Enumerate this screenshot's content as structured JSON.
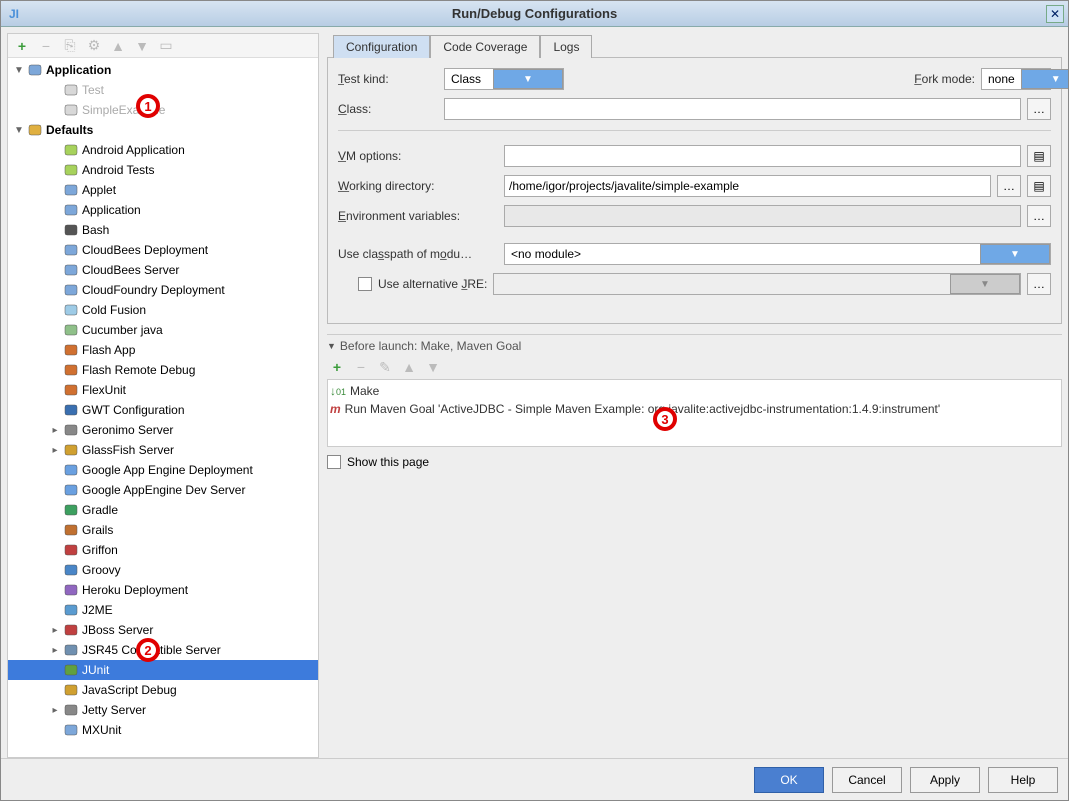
{
  "title": "Run/Debug Configurations",
  "toolbar": {
    "plus": "+",
    "minus": "−"
  },
  "tree": {
    "application": {
      "label": "Application",
      "items": [
        "Test",
        "SimpleExample"
      ]
    },
    "defaults": {
      "label": "Defaults",
      "items": [
        "Android Application",
        "Android Tests",
        "Applet",
        "Application",
        "Bash",
        "CloudBees Deployment",
        "CloudBees Server",
        "CloudFoundry Deployment",
        "Cold Fusion",
        "Cucumber java",
        "Flash App",
        "Flash Remote Debug",
        "FlexUnit",
        "GWT Configuration",
        "Geronimo Server",
        "GlassFish Server",
        "Google App Engine Deployment",
        "Google AppEngine Dev Server",
        "Gradle",
        "Grails",
        "Griffon",
        "Groovy",
        "Heroku Deployment",
        "J2ME",
        "JBoss Server",
        "JSR45 Compatible Server",
        "JUnit",
        "JavaScript Debug",
        "Jetty Server",
        "MXUnit"
      ],
      "selected_index": 26,
      "expandable_indices": [
        14,
        15,
        24,
        25,
        28
      ]
    }
  },
  "tabs": {
    "t0": "Configuration",
    "t1": "Code Coverage",
    "t2": "Logs"
  },
  "form": {
    "test_kind_label": "Test kind:",
    "test_kind_value": "Class",
    "fork_label": "Fork mode:",
    "fork_value": "none",
    "class_label": "Class:",
    "vm_label": "VM options:",
    "working_label": "Working directory:",
    "working_value": "/home/igor/projects/javalite/simple-example",
    "env_label": "Environment variables:",
    "classpath_label": "Use classpath of modu...",
    "classpath_value": "<no module>",
    "alt_jre_label": "Use alternative JRE:"
  },
  "before_launch": {
    "title": "Before launch: Make, Maven Goal",
    "items": [
      {
        "icon": "make",
        "text": "Make"
      },
      {
        "icon": "mvn",
        "text": "Run Maven Goal 'ActiveJDBC - Simple Maven Example: org.javalite:activejdbc-instrumentation:1.4.9:instrument'"
      }
    ],
    "show_page": "Show this page"
  },
  "buttons": {
    "ok": "OK",
    "cancel": "Cancel",
    "apply": "Apply",
    "help": "Help"
  },
  "markers": {
    "m1": "1",
    "m2": "2",
    "m3": "3"
  }
}
